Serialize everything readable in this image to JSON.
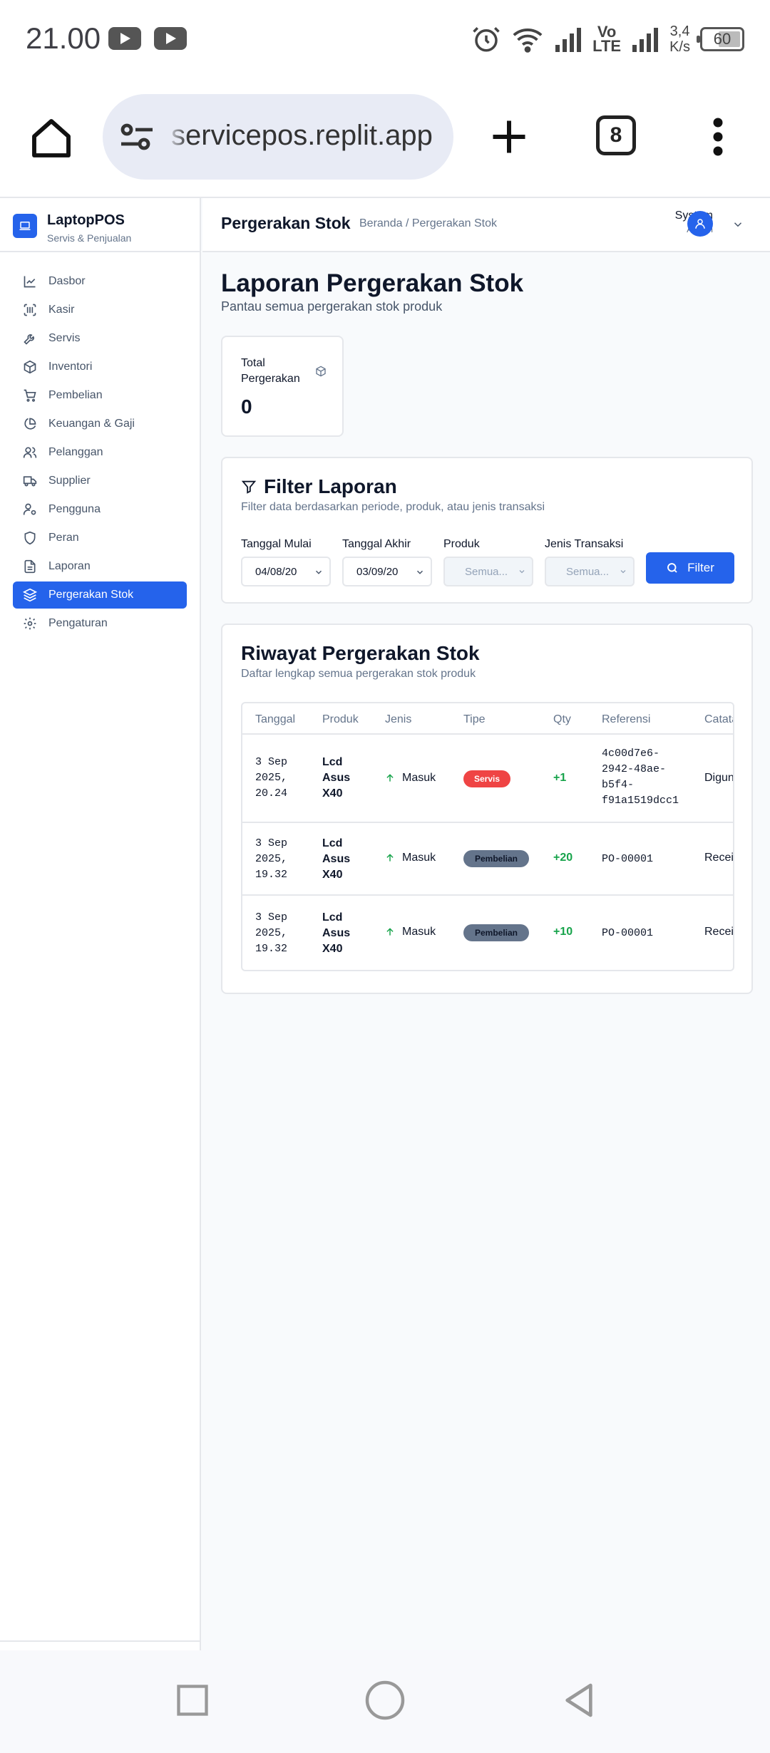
{
  "status_bar": {
    "time": "21.00",
    "volte_top": "Vo",
    "volte_bottom": "LTE",
    "speed_value": "3,4",
    "speed_unit": "K/s",
    "battery": "60"
  },
  "browser": {
    "url": "servicepos.replit.app",
    "tab_count": "8"
  },
  "brand": {
    "name": "LaptopPOS",
    "subtitle": "Servis & Penjualan"
  },
  "sidebar": {
    "items": [
      {
        "label": "Dasbor",
        "icon": "chart-line-icon"
      },
      {
        "label": "Kasir",
        "icon": "scan-barcode-icon"
      },
      {
        "label": "Servis",
        "icon": "wrench-icon"
      },
      {
        "label": "Inventori",
        "icon": "package-icon"
      },
      {
        "label": "Pembelian",
        "icon": "shopping-cart-icon"
      },
      {
        "label": "Keuangan & Gaji",
        "icon": "pie-chart-icon"
      },
      {
        "label": "Pelanggan",
        "icon": "users-icon"
      },
      {
        "label": "Supplier",
        "icon": "truck-icon"
      },
      {
        "label": "Pengguna",
        "icon": "user-cog-icon"
      },
      {
        "label": "Peran",
        "icon": "shield-icon"
      },
      {
        "label": "Laporan",
        "icon": "file-text-icon"
      },
      {
        "label": "Pergerakan Stok",
        "icon": "layers-icon",
        "active": true
      },
      {
        "label": "Pengaturan",
        "icon": "gear-icon"
      }
    ]
  },
  "header": {
    "title": "Pergerakan Stok",
    "breadcrumb": "Beranda / Pergerakan Stok",
    "user_name": "System",
    "user_role": "Admin"
  },
  "page": {
    "title": "Laporan Pergerakan Stok",
    "subtitle": "Pantau semua pergerakan stok produk"
  },
  "stat": {
    "label": "Total Pergerakan",
    "value": "0"
  },
  "filter": {
    "title": "Filter Laporan",
    "subtitle": "Filter data berdasarkan periode, produk, atau jenis transaksi",
    "start_label": "Tanggal Mulai",
    "start_value": "04/08/20",
    "end_label": "Tanggal Akhir",
    "end_value": "03/09/20",
    "product_label": "Produk",
    "product_value": "Semua...",
    "type_label": "Jenis Transaksi",
    "type_value": "Semua...",
    "button": "Filter"
  },
  "history": {
    "title": "Riwayat Pergerakan Stok",
    "subtitle": "Daftar lengkap semua pergerakan stok produk",
    "columns": [
      "Tanggal",
      "Produk",
      "Jenis",
      "Tipe",
      "Qty",
      "Referensi",
      "Catatan"
    ],
    "rows": [
      {
        "date": [
          "3 Sep",
          "2025,",
          "20.24"
        ],
        "product": [
          "Lcd",
          "Asus",
          "X40"
        ],
        "jenis": "Masuk",
        "tipe": "Servis",
        "tipe_color": "#ef4444",
        "qty": "+1",
        "ref": [
          "4c00d7e6-",
          "2942-48ae-",
          "b5f4-",
          "f91a1519dcc1"
        ],
        "note": "Digunakan"
      },
      {
        "date": [
          "3 Sep",
          "2025,",
          "19.32"
        ],
        "product": [
          "Lcd",
          "Asus",
          "X40"
        ],
        "jenis": "Masuk",
        "tipe": "Pembelian",
        "tipe_color": "#64748b",
        "qty": "+20",
        "ref": [
          "PO-00001"
        ],
        "note": "Received"
      },
      {
        "date": [
          "3 Sep",
          "2025,",
          "19.32"
        ],
        "product": [
          "Lcd",
          "Asus",
          "X40"
        ],
        "jenis": "Masuk",
        "tipe": "Pembelian",
        "tipe_color": "#64748b",
        "qty": "+10",
        "ref": [
          "PO-00001"
        ],
        "note": "Received"
      }
    ]
  }
}
